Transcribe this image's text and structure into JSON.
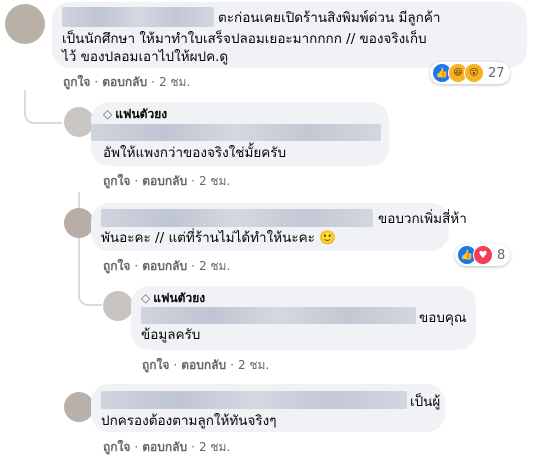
{
  "comments": [
    {
      "text_line1": "ตะก่อนเคยเปิดร้านสิงพิมพ์ด่วน มีลูกค้า",
      "text_line2": "เป็นนักศึกษา ให้มาทำใบเสร็จปลอมเยอะมากกกก // ของจริงเก็บ",
      "text_line3": "ไว้ ของปลอมเอาไปให้ผปค.ดู",
      "actions": {
        "like": "ถูกใจ",
        "reply": "ตอบกลับ",
        "time": "2 ชม."
      },
      "reactions": {
        "count": "27",
        "icons": [
          "like-icon",
          "haha-icon",
          "wow-icon"
        ]
      }
    },
    {
      "page_label": "แฟนตัวยง",
      "text_line1": "อัพให้แพงกว่าของจริงใช่มั้ยครับ",
      "actions": {
        "like": "ถูกใจ",
        "reply": "ตอบกลับ",
        "time": "2 ชม."
      }
    },
    {
      "text_line1": "ขอบวกเพิ่มสี่ห้า",
      "text_line2": "พันอะคะ // แต่ที่ร้านไม่ได้ทำให้นะคะ 🙂",
      "actions": {
        "like": "ถูกใจ",
        "reply": "ตอบกลับ",
        "time": "2 ชม."
      },
      "reactions": {
        "count": "8",
        "icons": [
          "like-icon",
          "love-icon"
        ]
      }
    },
    {
      "page_label": "แฟนตัวยง",
      "text_line1": "ขอบคุณ",
      "text_line2": "ข้อมูลครับ",
      "actions": {
        "like": "ถูกใจ",
        "reply": "ตอบกลับ",
        "time": "2 ชม."
      }
    },
    {
      "text_line1": "เป็นผู้",
      "text_line2": "ปกครองต้องตามลูกให้ทันจริงๆ",
      "actions": {
        "like": "ถูกใจ",
        "reply": "ตอบกลับ",
        "time": "2 ชม."
      }
    }
  ],
  "colors": {
    "bubble": "#f0f2f5",
    "meta": "#65676b",
    "like": "#1877f2",
    "love": "#f33e58",
    "haha": "#f7b125"
  }
}
